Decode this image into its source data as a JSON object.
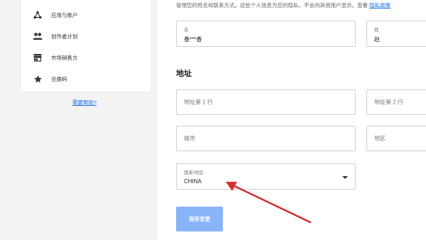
{
  "sidebar": {
    "items": [
      {
        "label": "应用与账户",
        "icon": "triangle-nodes-icon"
      },
      {
        "label": "创作者计划",
        "icon": "people-icon"
      },
      {
        "label": "市场销售方",
        "icon": "store-icon"
      },
      {
        "label": "兑换码",
        "icon": "star-icon"
      }
    ],
    "help_link": "需要帮助?"
  },
  "form": {
    "intro_text": "管理您的姓名和联系方式。这些个人信息为您的隐私，不会向其他用户显示。查看",
    "privacy_link": "隐私政策",
    "first_name": {
      "label": "名",
      "value": "香***香"
    },
    "last_name": {
      "label": "姓",
      "value": "赵"
    },
    "address_title": "地址",
    "address_line1": {
      "placeholder": "地址第 1 行"
    },
    "address_line2": {
      "placeholder": "地址第 2 行"
    },
    "city": {
      "placeholder": "城市"
    },
    "region": {
      "placeholder": "地区"
    },
    "country": {
      "label": "国家/地区",
      "value": "CHINA"
    },
    "save_button": "保存变更"
  },
  "colors": {
    "accent": "#1a73e8",
    "button": "#8ab4f8",
    "annotation_arrow": "#d32f2f"
  }
}
